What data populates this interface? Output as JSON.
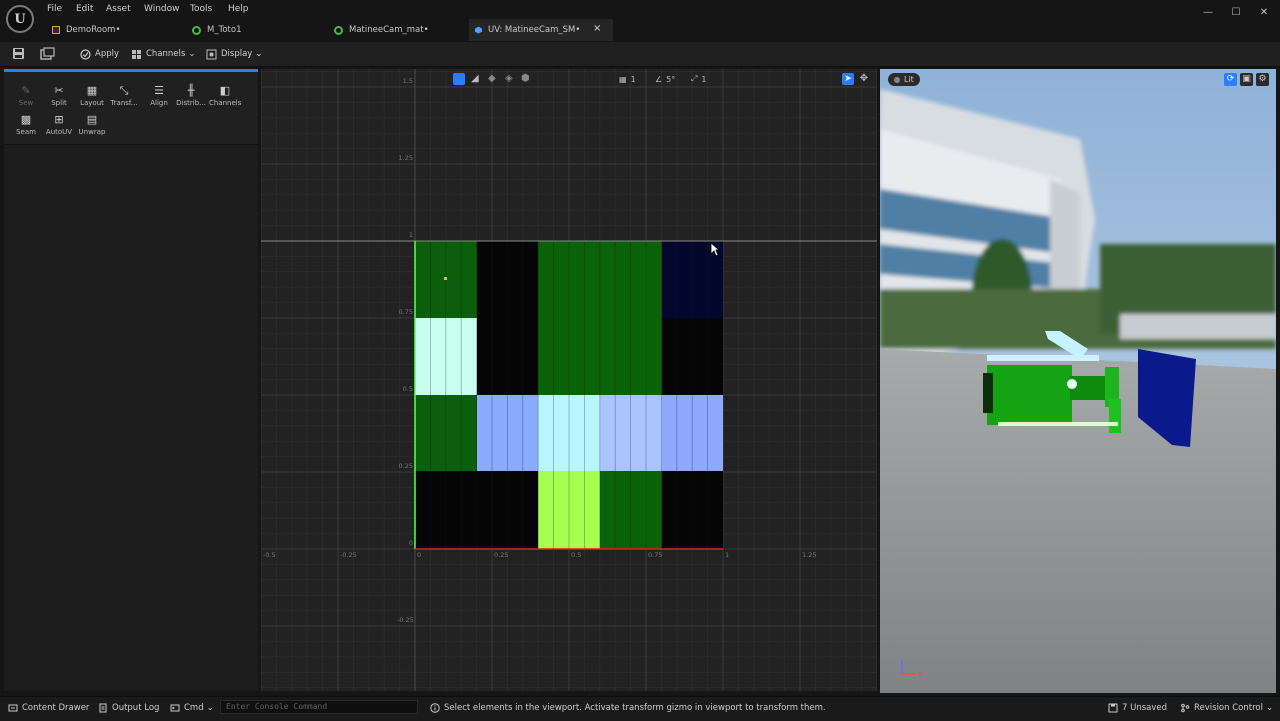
{
  "menu": [
    "File",
    "Edit",
    "Asset",
    "Window",
    "Tools",
    "Help"
  ],
  "tabs": [
    {
      "label": "DemoRoom•",
      "active": false
    },
    {
      "label": "M_Toto1",
      "active": false
    },
    {
      "label": "MatineeCam_mat•",
      "active": false
    },
    {
      "label": "UV: MatineeCam_SM•",
      "active": true
    }
  ],
  "tab_close": "×",
  "window_controls": {
    "minimize": "—",
    "maximize": "☐",
    "close": "✕"
  },
  "toolbar": {
    "apply": "Apply",
    "channels": "Channels",
    "display": "Display"
  },
  "tools": [
    "Sew",
    "Split",
    "Layout",
    "Transf...",
    "Align",
    "Distrib...",
    "Channels",
    "Seam",
    "AutoUV",
    "Unwrap"
  ],
  "uv_toolbar": {
    "grid_value": "1",
    "angle_value": "5°",
    "scale_value": "1"
  },
  "axis_labels": {
    "x": [
      "-0.5",
      "-0.25",
      "0",
      "0.25",
      "0.5",
      "0.75",
      "1",
      "1.25"
    ],
    "y": [
      "1.5",
      "1.25",
      "1",
      "0.75",
      "0.5",
      "0.25",
      "0",
      "-0.25"
    ]
  },
  "viewport": {
    "mode": "Lit"
  },
  "status": {
    "content_drawer": "Content Drawer",
    "output_log": "Output Log",
    "cmd": "Cmd",
    "console_placeholder": "Enter Console Command",
    "hint": "Select elements in the viewport. Activate transform gizmo in viewport to transform them.",
    "unsaved": "7 Unsaved",
    "revision": "Revision Control"
  },
  "colors": {
    "accent": "#2a7fff",
    "uv_green": "#0b6b0b",
    "uv_lightblue": "#a9c4ff",
    "uv_lime": "#a6ff4f",
    "uv_cyan": "#b6ffee"
  }
}
